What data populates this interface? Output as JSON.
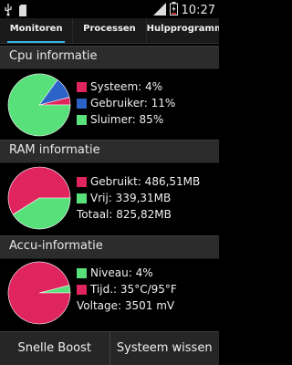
{
  "status_bar": {
    "time": "10:27"
  },
  "tabs": [
    {
      "label": "Monitoren"
    },
    {
      "label": "Processen"
    },
    {
      "label": "Hulpprogramma's"
    }
  ],
  "cpu": {
    "title": "Cpu informatie",
    "items": [
      {
        "label": "Systeem: 4%",
        "value": 4,
        "color": "#e0245e"
      },
      {
        "label": "Gebruiker: 11%",
        "value": 11,
        "color": "#2b63c8"
      },
      {
        "label": "Sluimer: 85%",
        "value": 85,
        "color": "#58e07a"
      }
    ]
  },
  "ram": {
    "title": "RAM informatie",
    "items": [
      {
        "label": "Gebruikt: 486,51MB",
        "value": 486.51,
        "color": "#e0245e"
      },
      {
        "label": "Vrij: 339,31MB",
        "value": 339.31,
        "color": "#58e07a"
      }
    ],
    "total": "Totaal: 825,82MB"
  },
  "battery": {
    "title": "Accu-informatie",
    "items": [
      {
        "label": "Niveau: 4%",
        "value": 4,
        "color": "#58e07a"
      },
      {
        "label": "Tijd.: 35°C/95°F",
        "value": 96,
        "color": "#e0245e"
      }
    ],
    "voltage": "Voltage: 3501 mV"
  },
  "bottom": {
    "boost_label": "Snelle Boost",
    "clear_label": "Systeem wissen"
  }
}
